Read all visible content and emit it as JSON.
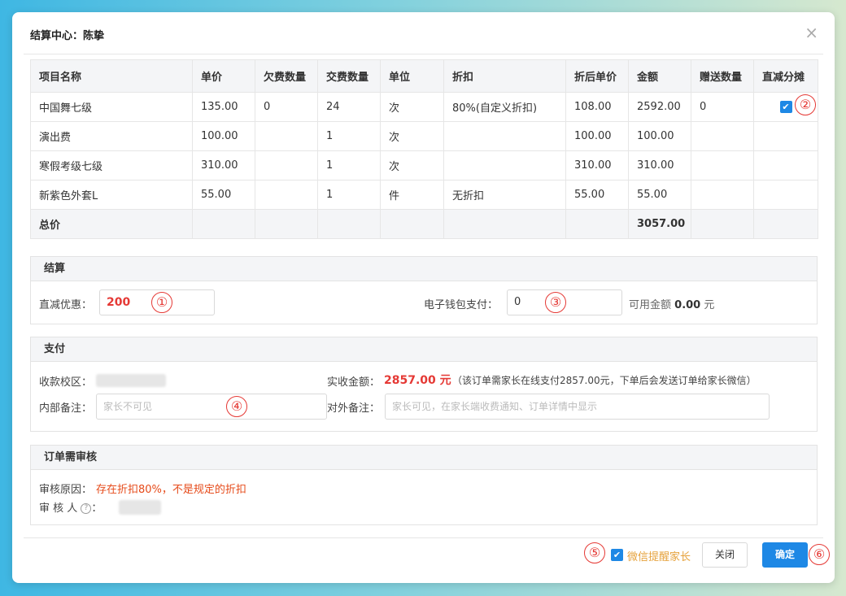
{
  "dialog": {
    "title": "结算中心：陈挚",
    "close_symbol": "×"
  },
  "items_table": {
    "headers": [
      "项目名称",
      "单价",
      "欠费数量",
      "交费数量",
      "单位",
      "折扣",
      "折后单价",
      "金额",
      "赠送数量",
      "直减分摊"
    ],
    "rows": [
      [
        "中国舞七级",
        "135.00",
        "0",
        "24",
        "次",
        "80%(自定义折扣)",
        "108.00",
        "2592.00",
        "0",
        ""
      ],
      [
        "演出费",
        "100.00",
        "",
        "1",
        "次",
        "",
        "100.00",
        "100.00",
        "",
        ""
      ],
      [
        "寒假考级七级",
        "310.00",
        "",
        "1",
        "次",
        "",
        "310.00",
        "310.00",
        "",
        ""
      ],
      [
        "新紫色外套L",
        "55.00",
        "",
        "1",
        "件",
        "无折扣",
        "55.00",
        "55.00",
        "",
        ""
      ]
    ],
    "total_label": "总价",
    "total_amount": "3057.00",
    "checkmark": "✔"
  },
  "settlement": {
    "title": "结算",
    "discount_label": "直减优惠：",
    "discount_value": "200",
    "wallet_label": "电子钱包支付：",
    "wallet_value": "0",
    "available_prefix": "可用金额",
    "available_amount": "0.00",
    "available_unit": "元"
  },
  "payment": {
    "title": "支付",
    "campus_label": "收款校区：",
    "actual_label": "实收金额：",
    "actual_amount": "2857.00 元",
    "actual_note": "（该订单需家长在线支付2857.00元，下单后会发送订单给家长微信）",
    "internal_note_label": "内部备注：",
    "internal_note_placeholder": "家长不可见",
    "external_note_label": "对外备注：",
    "external_note_placeholder": "家长可见，在家长端收费通知、订单详情中显示"
  },
  "review": {
    "title": "订单需审核",
    "reason_label": "审核原因：",
    "reason_text": "存在折扣80%，不是规定的折扣",
    "reviewer_label": "审 核 人",
    "help_symbol": "?",
    "colon": "："
  },
  "footer": {
    "wechat_remind_label": "微信提醒家长",
    "close_button": "关闭",
    "confirm_button": "确定"
  },
  "markers": [
    "①",
    "②",
    "③",
    "④",
    "⑤",
    "⑥"
  ],
  "colors": {
    "primary": "#1e88e5",
    "danger": "#e53935",
    "warning_text": "#e6a23c",
    "review_reason": "#e64a19"
  }
}
